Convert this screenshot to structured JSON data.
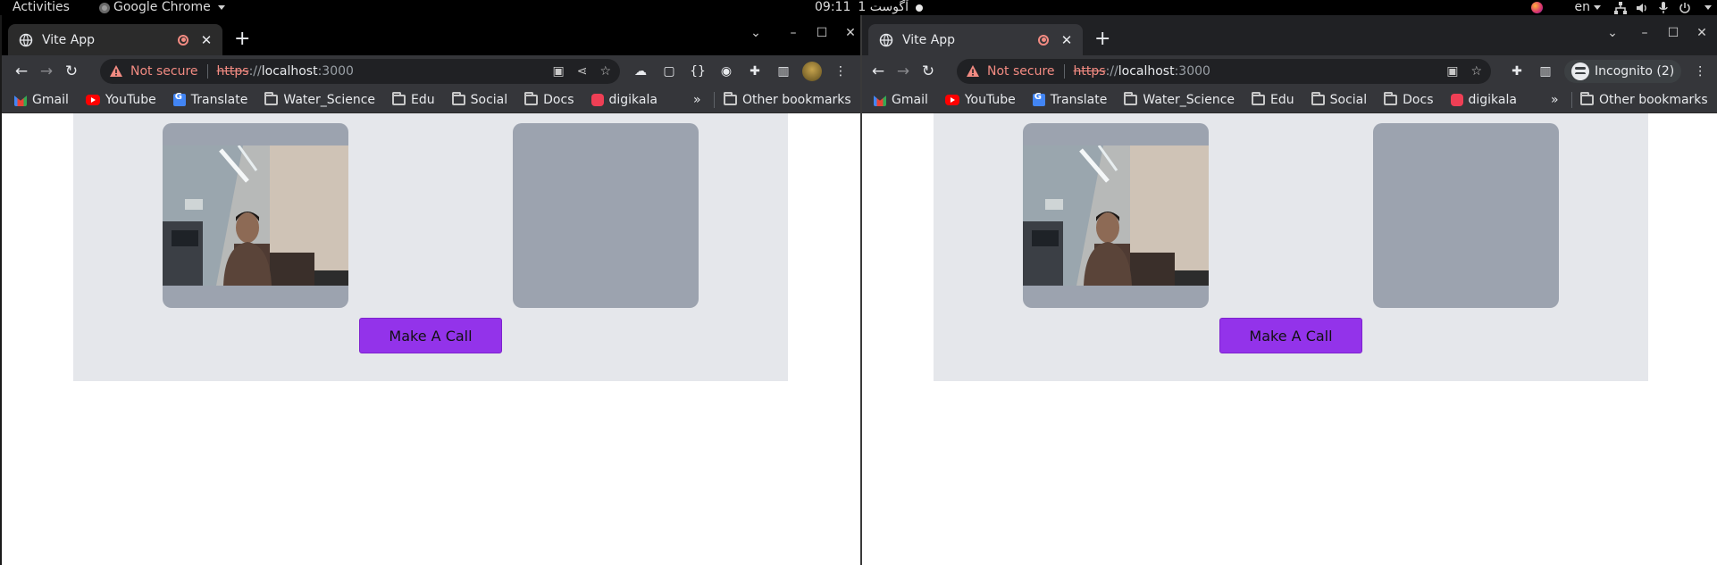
{
  "system_bar": {
    "activities": "Activities",
    "app_name": "Google Chrome",
    "clock_time": "09:11",
    "clock_date": "1 آگوست",
    "language": "en"
  },
  "browser_left": {
    "tab_title": "Vite App",
    "url": {
      "security_label": "Not secure",
      "scheme": "https",
      "separator": "://",
      "host": "localhost",
      "port": ":3000"
    },
    "bookmarks": [
      "Gmail",
      "YouTube",
      "Translate",
      "Water_Science",
      "Edu",
      "Social",
      "Docs",
      "digikala"
    ],
    "more_bookmarks": "»",
    "other_bookmarks": "Other bookmarks"
  },
  "browser_right": {
    "tab_title": "Vite App",
    "url": {
      "security_label": "Not secure",
      "scheme": "https",
      "separator": "://",
      "host": "localhost",
      "port": ":3000"
    },
    "incognito_label": "Incognito (2)",
    "bookmarks": [
      "Gmail",
      "YouTube",
      "Translate",
      "Water_Science",
      "Edu",
      "Social",
      "Docs",
      "digikala"
    ],
    "more_bookmarks": "»",
    "other_bookmarks": "Other bookmarks"
  },
  "app": {
    "call_button_label": "Make A Call",
    "accent_color": "#9333ea",
    "panel_color": "#e5e7eb",
    "video_placeholder_color": "#9ca3af"
  },
  "icons": {
    "tab": [
      "globe-icon",
      "recording-icon",
      "close-icon"
    ],
    "omnibox": [
      "warning-icon",
      "camera-icon",
      "share-icon",
      "star-icon"
    ],
    "toolbar": [
      "extensions-icon",
      "side-panel-icon",
      "menu-icon",
      "profile-avatar"
    ],
    "system": [
      "firefox-icon",
      "network-icon",
      "volume-icon",
      "microphone-icon",
      "power-icon"
    ]
  }
}
